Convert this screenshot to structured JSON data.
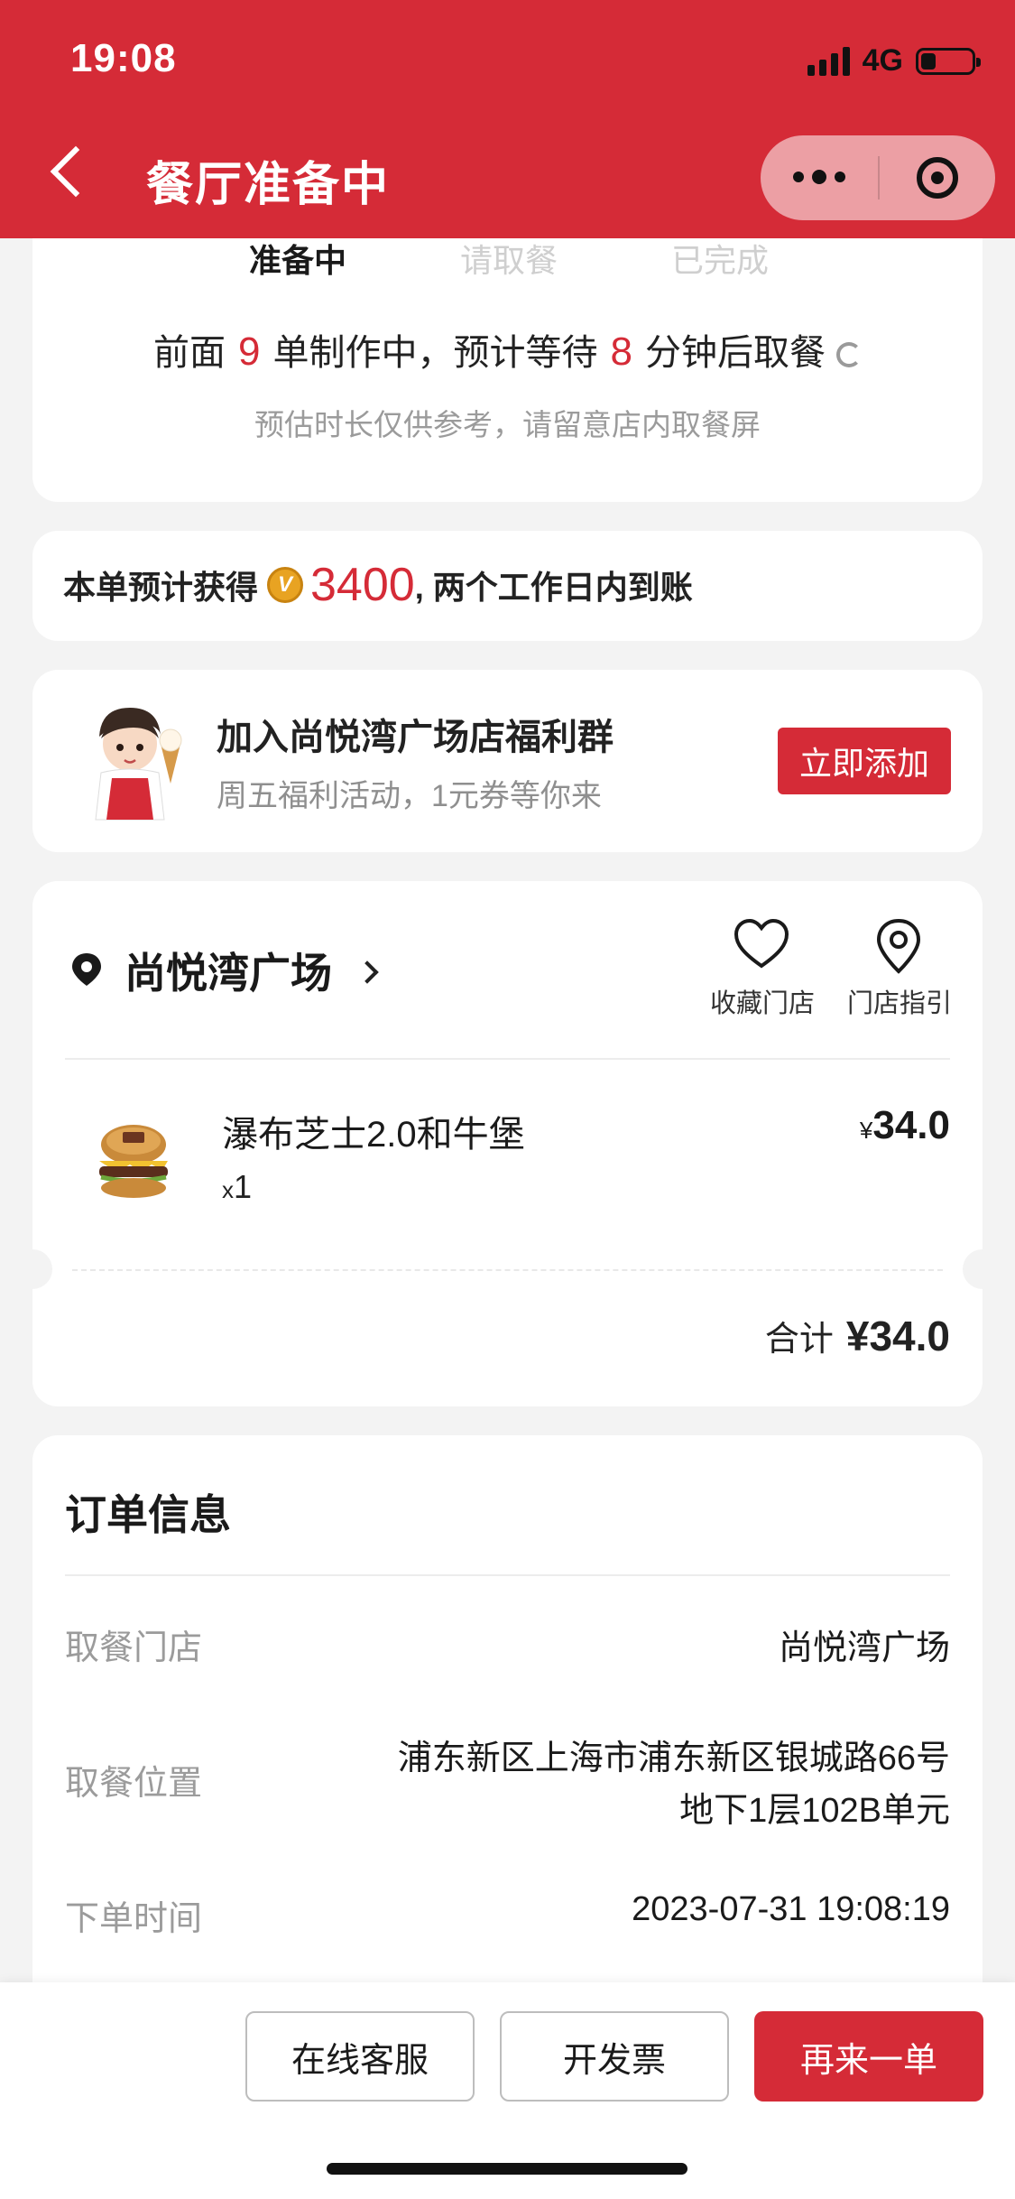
{
  "status_bar": {
    "time": "19:08",
    "network": "4G",
    "battery_level": 0.3
  },
  "header": {
    "title": "餐厅准备中",
    "back_icon": "chevron-left-icon",
    "more_icon": "more-dots-icon",
    "close_icon": "record-close-icon"
  },
  "progress": {
    "steps": [
      {
        "label": "准备中",
        "state": "active"
      },
      {
        "label": "请取餐",
        "state": "pending"
      },
      {
        "label": "已完成",
        "state": "pending"
      }
    ],
    "queue_prefix": "前面",
    "queue_count": "9",
    "queue_middle": "单制作中，预计等待",
    "wait_minutes": "8",
    "queue_suffix": "分钟后取餐",
    "note": "预估时长仅供参考，请留意店内取餐屏"
  },
  "points": {
    "prefix": "本单预计获得",
    "amount": "3400",
    "suffix": ", 两个工作日内到账"
  },
  "group": {
    "title": "加入尚悦湾广场店福利群",
    "subtitle": "周五福利活动，1元券等你来",
    "button": "立即添加"
  },
  "store": {
    "name": "尚悦湾广场",
    "favorite_label": "收藏门店",
    "guide_label": "门店指引"
  },
  "order_item": {
    "name": "瀑布芝士2.0和牛堡",
    "qty_prefix": "x",
    "qty": "1",
    "currency": "¥",
    "price": "34.0"
  },
  "total": {
    "label": "合计",
    "amount": "¥34.0"
  },
  "order_info": {
    "title": "订单信息",
    "rows": [
      {
        "label": "取餐门店",
        "value": "尚悦湾广场"
      },
      {
        "label": "取餐位置",
        "value_line1": "浦东新区上海市浦东新区银城路66号",
        "value_line2": "地下1层102B单元"
      },
      {
        "label": "下单时间",
        "value": "2023-07-31 19:08:19"
      }
    ]
  },
  "actions": {
    "service": "在线客服",
    "invoice": "开发票",
    "reorder": "再来一单"
  },
  "colors": {
    "brand_red": "#d52b37",
    "page_bg": "#f3f3f3",
    "muted_text": "#9b9b9b"
  }
}
